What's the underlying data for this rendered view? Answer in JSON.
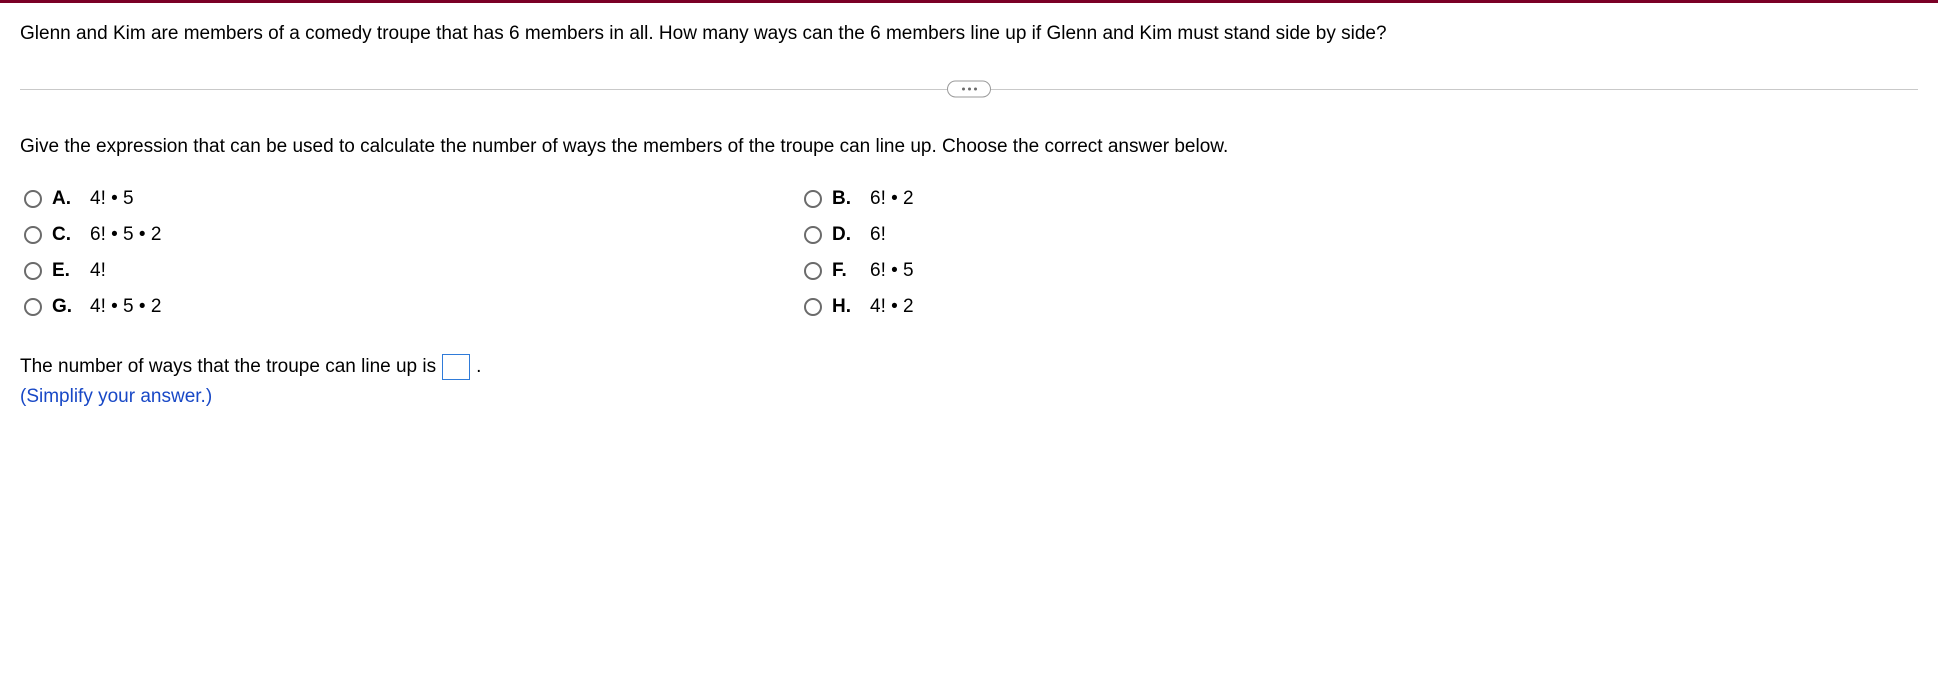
{
  "question": "Glenn and Kim are members of a comedy troupe that has 6 members in all. How many ways can the 6 members line up if Glenn and Kim must stand side by side?",
  "instruction": "Give the expression that can be used to calculate the number of ways the members of the troupe can line up. Choose the correct answer below.",
  "options": {
    "A": {
      "letter": "A.",
      "text": "4! • 5"
    },
    "B": {
      "letter": "B.",
      "text": "6! • 2"
    },
    "C": {
      "letter": "C.",
      "text": "6! • 5 • 2"
    },
    "D": {
      "letter": "D.",
      "text": "6!"
    },
    "E": {
      "letter": "E.",
      "text": "4!"
    },
    "F": {
      "letter": "F.",
      "text": "6! • 5"
    },
    "G": {
      "letter": "G.",
      "text": "4! • 5 • 2"
    },
    "H": {
      "letter": "H.",
      "text": "4! • 2"
    }
  },
  "answer_prefix": "The number of ways that the troupe can line up is ",
  "answer_suffix": ".",
  "hint": "(Simplify your answer.)"
}
